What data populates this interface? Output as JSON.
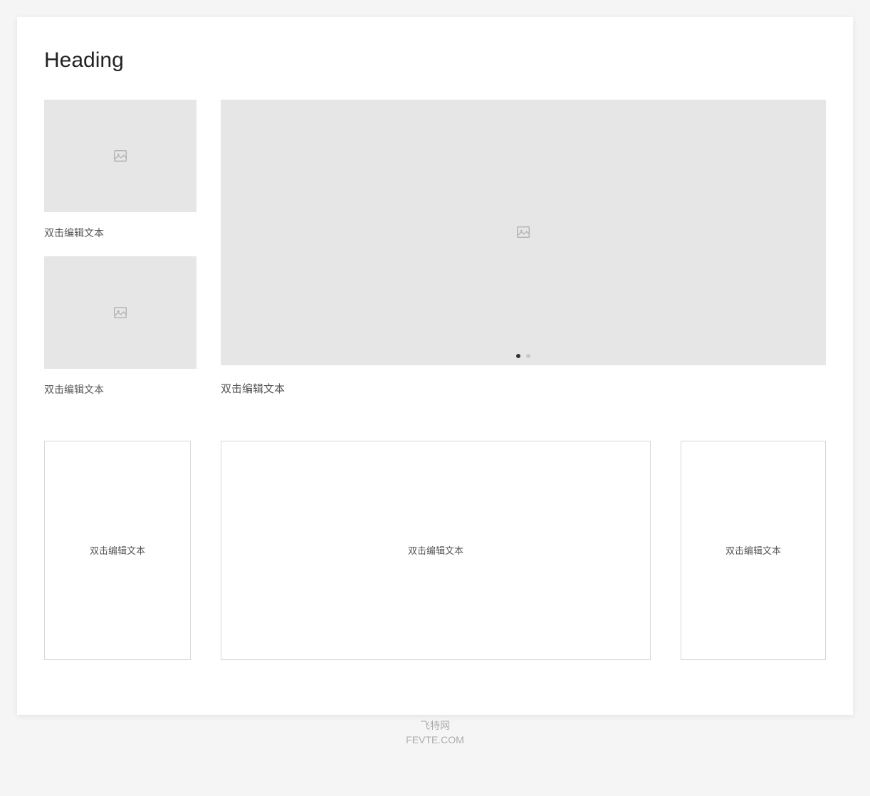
{
  "heading": "Heading",
  "leftColumn": {
    "items": [
      {
        "caption": "双击编辑文本"
      },
      {
        "caption": "双击编辑文本"
      }
    ]
  },
  "carousel": {
    "caption": "双击编辑文本",
    "dots": 2,
    "activeDot": 0
  },
  "bottomRow": {
    "boxes": [
      {
        "text": "双击编辑文本"
      },
      {
        "text": "双击编辑文本"
      },
      {
        "text": "双击编辑文本"
      }
    ]
  },
  "watermark": {
    "line1": "飞特网",
    "line2": "FEVTE.COM"
  }
}
